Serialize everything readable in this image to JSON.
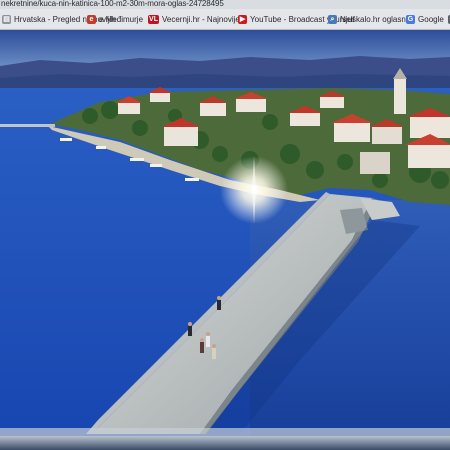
{
  "browser": {
    "url_text": "nekretnine/kuca-nin-katinica-100-m2-30m-mora-oglas-24728495"
  },
  "bookmarks": [
    {
      "label": "Hrvatska - Pregled najnovijih",
      "icon": "document-icon",
      "color": "#7a7f87"
    },
    {
      "label": "e Međimurje",
      "icon": "emedjimurje-icon",
      "color": "#c43a2f"
    },
    {
      "label": "Vecernji.hr - Najnovije",
      "icon": "vl-logo-icon",
      "color": "#c0171e"
    },
    {
      "label": "YouTube - Broadcast yourself",
      "icon": "youtube-icon",
      "color": "#d1161c"
    },
    {
      "label": "Njuskalo.hr oglasnik",
      "icon": "magnifier-icon",
      "color": "#4a7ab0"
    },
    {
      "label": "Google",
      "icon": "google-icon",
      "color": "#4a7ae0"
    },
    {
      "label": "",
      "icon": "gear-icon",
      "color": "#5b5f66"
    }
  ]
}
